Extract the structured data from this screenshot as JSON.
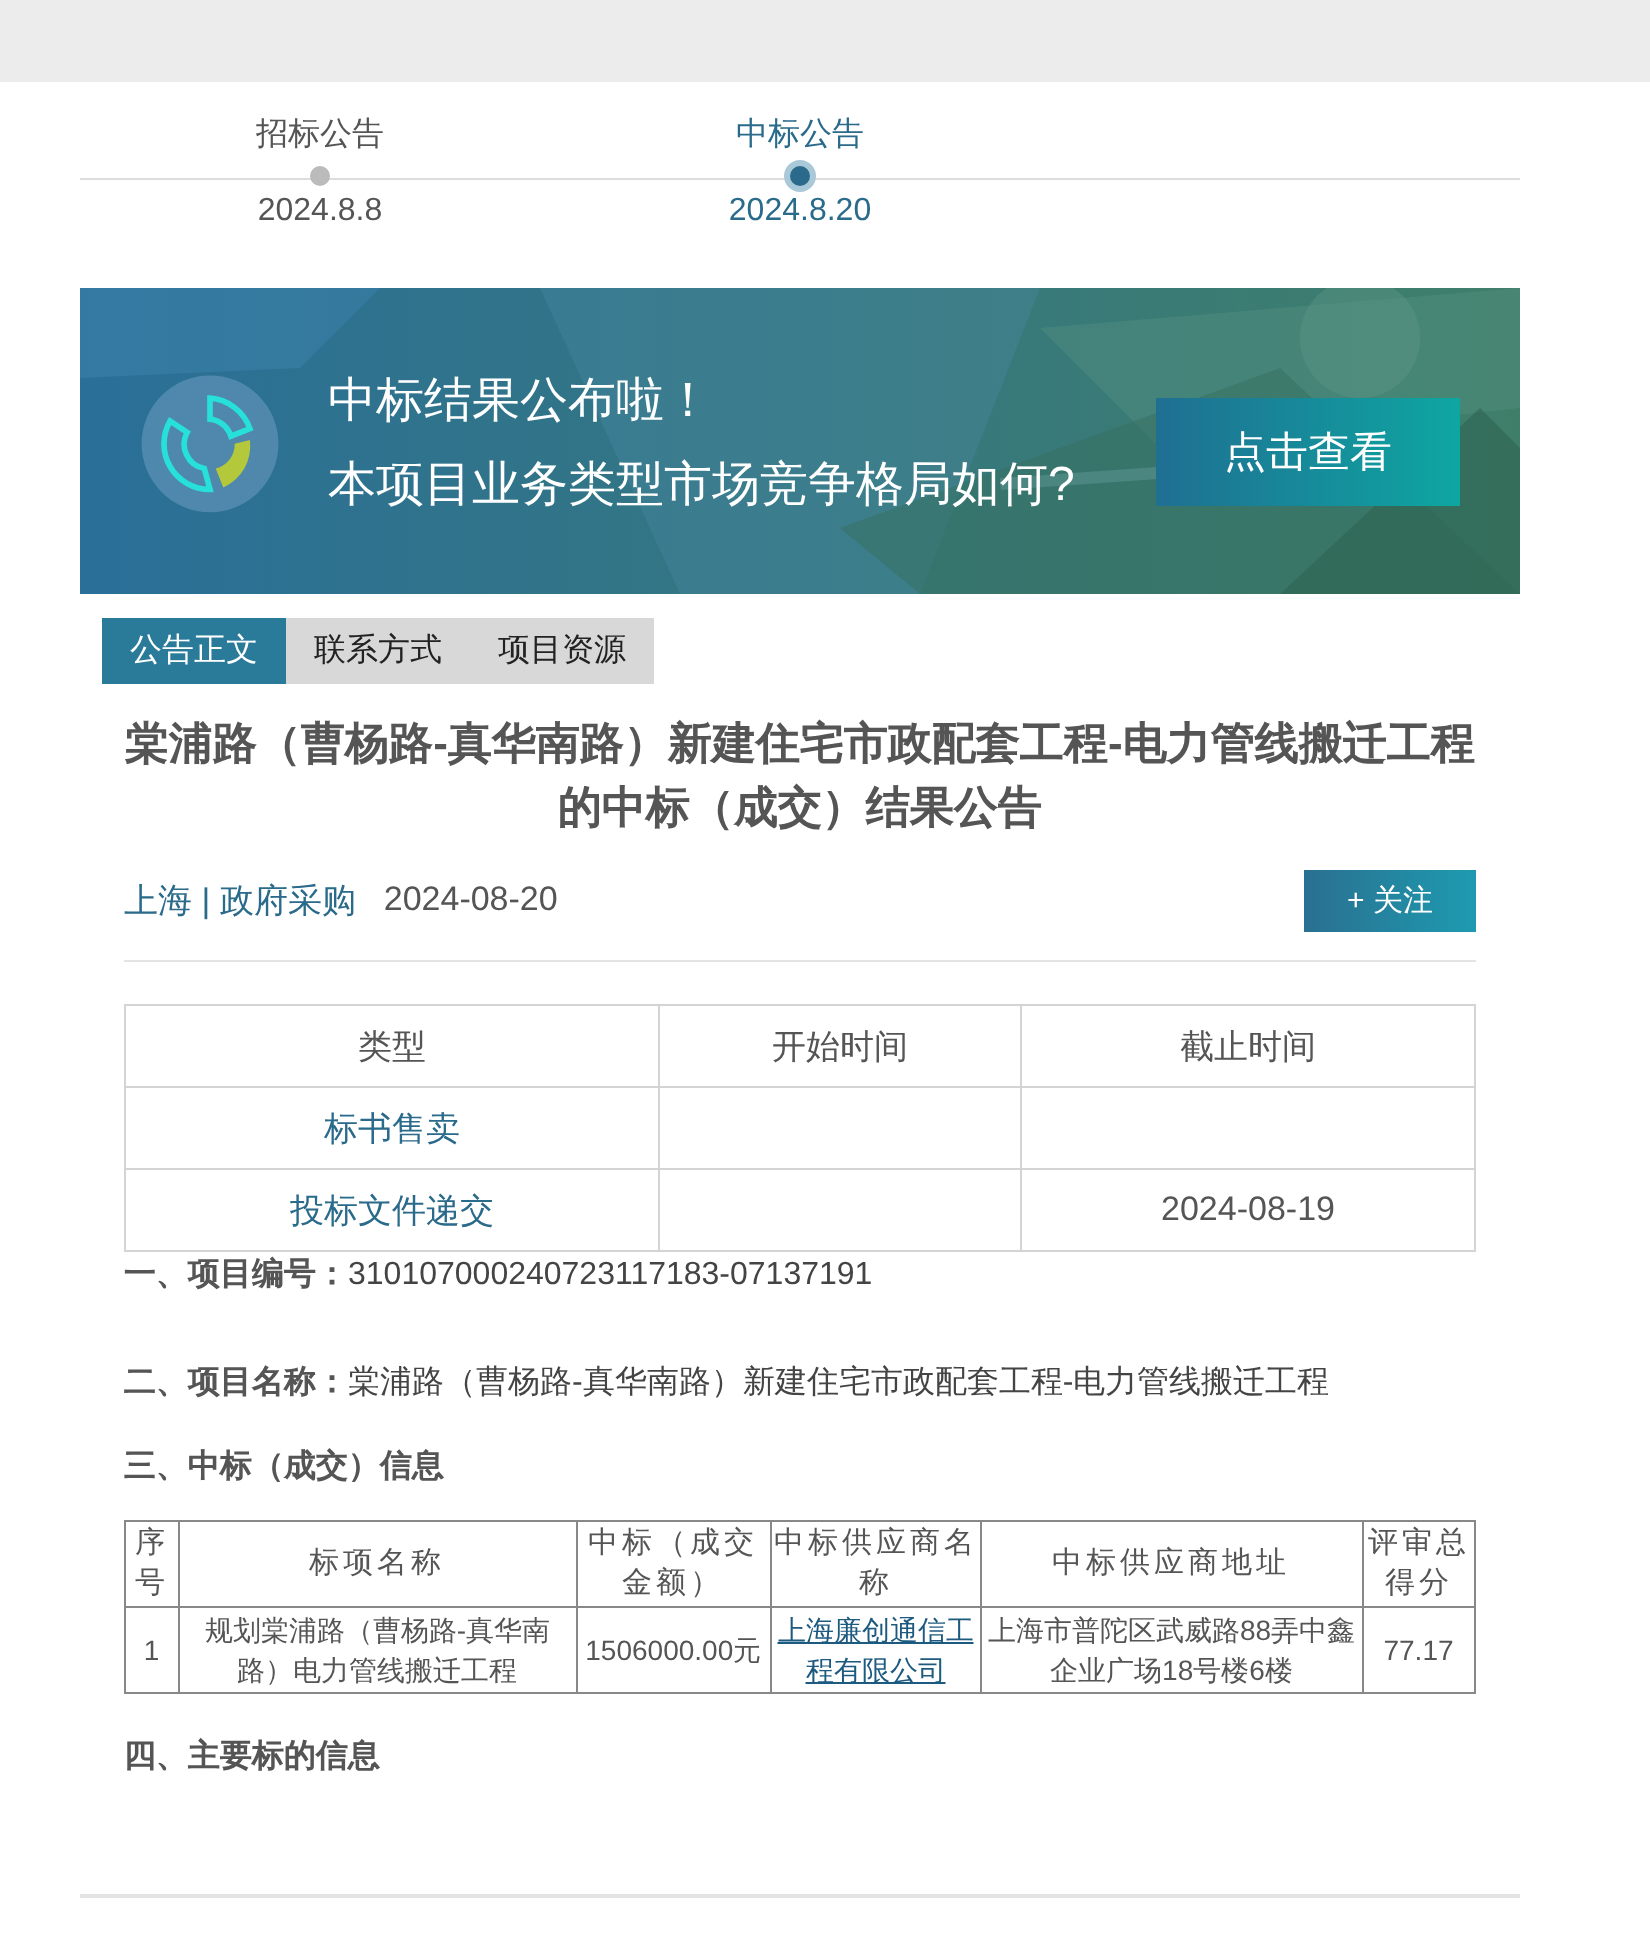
{
  "timeline": [
    {
      "label": "招标公告",
      "date": "2024.8.8",
      "selected": false
    },
    {
      "label": "中标公告",
      "date": "2024.8.20",
      "selected": true
    }
  ],
  "banner": {
    "headline": "中标结果公布啦！",
    "question": "本项目业务类型市场竞争格局如何?",
    "button": "点击查看"
  },
  "tabs": [
    {
      "label": "公告正文",
      "selected": true
    },
    {
      "label": "联系方式",
      "selected": false
    },
    {
      "label": "项目资源",
      "selected": false
    }
  ],
  "title": "棠浦路（曹杨路-真华南路）新建住宅市政配套工程-电力管线搬迁工程的中标（成交）结果公告",
  "meta": {
    "location": "上海 | 政府采购",
    "date": "2024-08-20"
  },
  "follow_button": "+ 关注",
  "schedule_table": {
    "columns": [
      "类型",
      "开始时间",
      "截止时间"
    ],
    "rows": [
      [
        "标书售卖",
        "",
        ""
      ],
      [
        "投标文件递交",
        "",
        "2024-08-19"
      ]
    ]
  },
  "project_number": {
    "heading": "一、项目编号：",
    "value": "310107000240723117183-07137191"
  },
  "project_name": {
    "heading": "二、项目名称：",
    "value": "棠浦路（曹杨路-真华南路）新建住宅市政配套工程-电力管线搬迁工程"
  },
  "award_heading": "三、中标（成交）信息",
  "award_table": {
    "columns": [
      "序号",
      "标项名称",
      "中标（成交金额）",
      "中标供应商名称",
      "中标供应商地址",
      "评审总得分"
    ],
    "rows": [
      {
        "index": "1",
        "item": "规划棠浦路（曹杨路-真华南路）电力管线搬迁工程",
        "amount": "1506000.00元",
        "supplier": "上海廉创通信工程有限公司",
        "address": "上海市普陀区武威路88弄中鑫企业广场18号楼6楼",
        "score": "77.17"
      }
    ]
  },
  "main_items_heading": "四、主要标的信息"
}
